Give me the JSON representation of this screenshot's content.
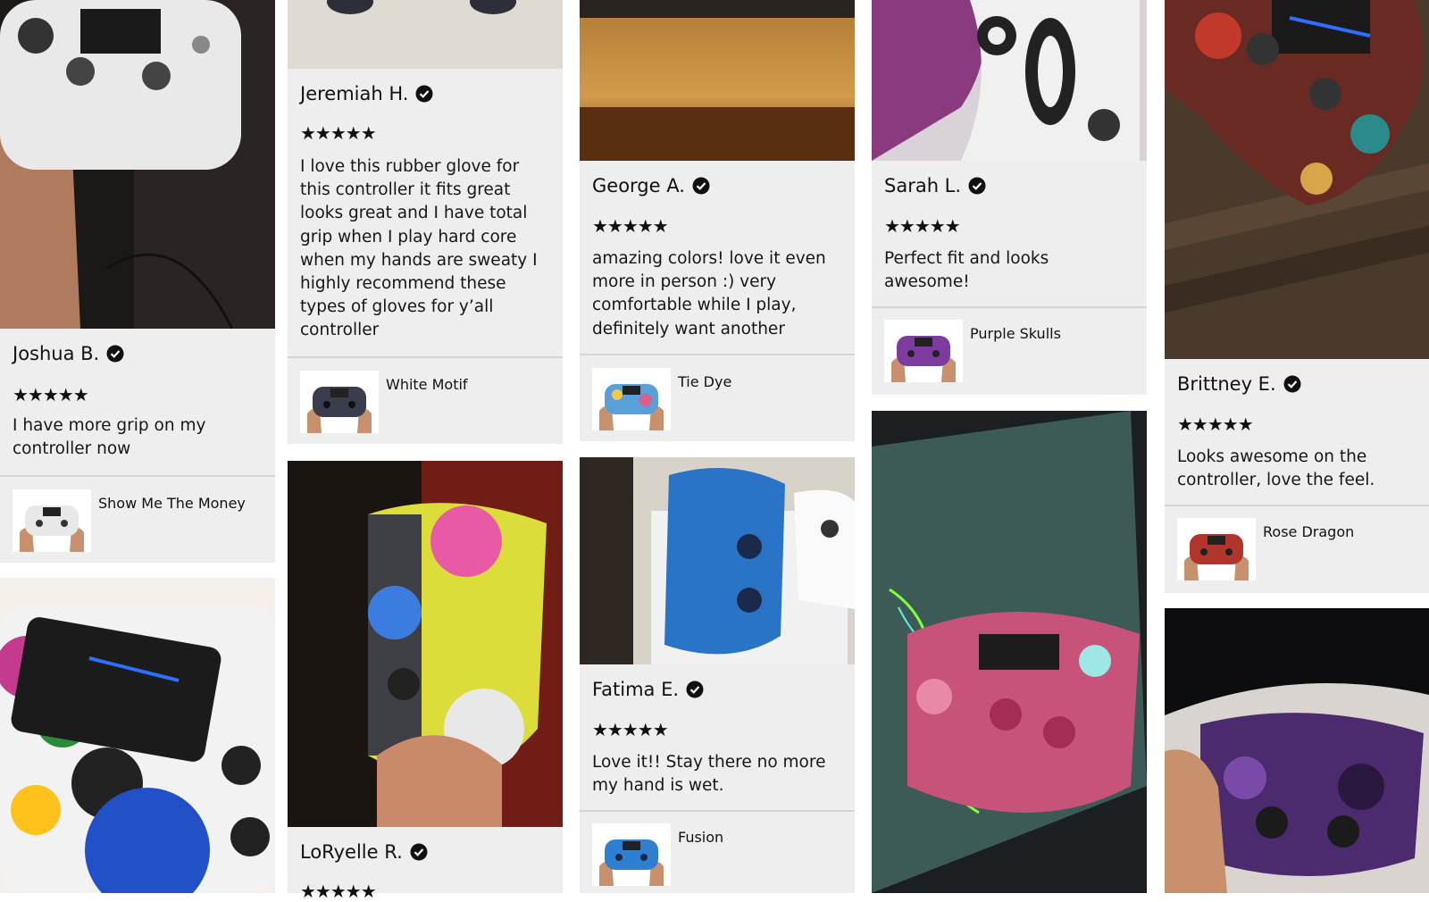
{
  "reviews": [
    {
      "name": "Joshua B.",
      "rating": 5,
      "stars": "★★★★★",
      "text": "I have more grip on my controller now",
      "variant": "Show Me The Money",
      "pattern_color": "#e8e8e8"
    },
    {
      "name": "Jeremiah H.",
      "rating": 5,
      "stars": "★★★★★",
      "text": "I love this rubber glove for this controller it fits great looks great and I have total grip when I play hard core when my hands are sweaty I highly recommend these types of gloves for y’all controller",
      "variant": "White Motif",
      "pattern_color": "#f3f3f3"
    },
    {
      "name": "LoRyelle R.",
      "rating": 5,
      "stars": "★★★★★"
    },
    {
      "name": "George A.",
      "rating": 5,
      "stars": "★★★★★",
      "text": "amazing colors! love it even more in person :) very comfortable while I play, definitely want another",
      "variant": "Tie Dye",
      "pattern_color": "#f2c94c"
    },
    {
      "name": "Fatima E.",
      "rating": 5,
      "stars": "★★★★★",
      "text": "Love it!! Stay there no more my hand is wet.",
      "variant": "Fusion",
      "pattern_color": "#2f7fd1"
    },
    {
      "name": "Sarah L.",
      "rating": 5,
      "stars": "★★★★★",
      "text": "Perfect fit and looks awesome!",
      "variant": "Purple Skulls",
      "pattern_color": "#7d3b9e"
    },
    {
      "name": "Brittney E.",
      "rating": 5,
      "stars": "★★★★★",
      "text": "Looks awesome on the controller, love the feel.",
      "variant": "Rose Dragon",
      "pattern_color": "#b0362c"
    }
  ],
  "colors": {
    "card_background": "#eeeeee",
    "divider": "#d4d4d4",
    "text": "#111111",
    "verified_badge": "#111111"
  },
  "icons": {
    "verified": "verified-check-icon",
    "star": "star-icon"
  }
}
